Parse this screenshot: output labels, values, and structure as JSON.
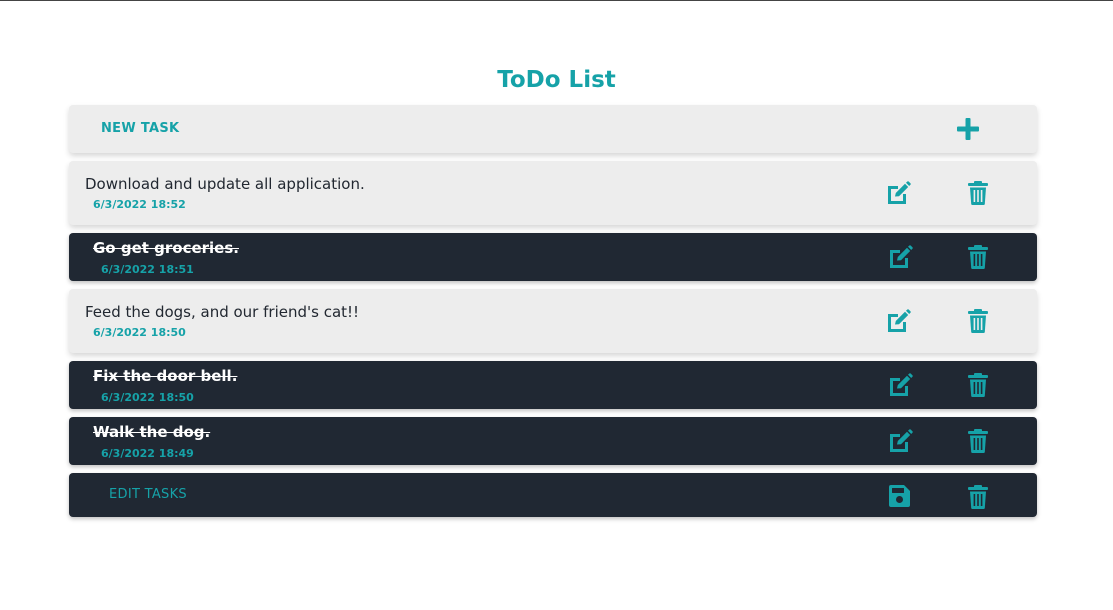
{
  "app": {
    "title": "ToDo List"
  },
  "new_task": {
    "label": "NEW TASK",
    "add_icon": "plus-icon"
  },
  "tasks": [
    {
      "text": "Download and update all application.",
      "timestamp": "6/3/2022 18:52",
      "completed": false
    },
    {
      "text": "Go get groceries.",
      "timestamp": "6/3/2022 18:51",
      "completed": true
    },
    {
      "text": "Feed the dogs, and our friend's cat!!",
      "timestamp": "6/3/2022 18:50",
      "completed": false
    },
    {
      "text": "Fix the door bell.",
      "timestamp": "6/3/2022 18:50",
      "completed": true
    },
    {
      "text": "Walk the dog.",
      "timestamp": "6/3/2022 18:49",
      "completed": true
    }
  ],
  "task_actions": {
    "edit_icon": "edit-icon",
    "delete_icon": "trash-icon"
  },
  "edit_tasks": {
    "label": "EDIT TASKS",
    "save_icon": "save-icon",
    "delete_icon": "trash-icon"
  },
  "colors": {
    "accent": "#16a2a8",
    "light_row": "#ededed",
    "dark_row": "#202833",
    "text_dark": "#222831",
    "text_light": "#ffffff"
  }
}
